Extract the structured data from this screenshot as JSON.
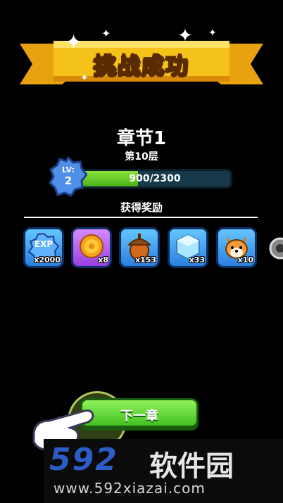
{
  "banner": {
    "title": "挑战成功"
  },
  "chapter": {
    "title": "章节1",
    "floor": "第10层"
  },
  "level": {
    "label": "LV:",
    "value": "2"
  },
  "exp": {
    "text": "900/2300",
    "progress": 0.39
  },
  "rewards_title": "获得奖励",
  "rewards": [
    {
      "icon": "exp-icon",
      "icon_text": "EXP",
      "count": "x2000",
      "color": "blue"
    },
    {
      "icon": "gold-coin-icon",
      "count": "x8",
      "color": "purple"
    },
    {
      "icon": "acorn-icon",
      "count": "x153",
      "color": "blue"
    },
    {
      "icon": "ice-cube-icon",
      "count": "x33",
      "color": "blue"
    },
    {
      "icon": "shiba-dog-icon",
      "count": "x10",
      "color": "blue"
    }
  ],
  "next_button": {
    "label": "下一章"
  },
  "watermark": {
    "logo": "592",
    "name": "软件园",
    "url": "www.592xiazai.com"
  }
}
